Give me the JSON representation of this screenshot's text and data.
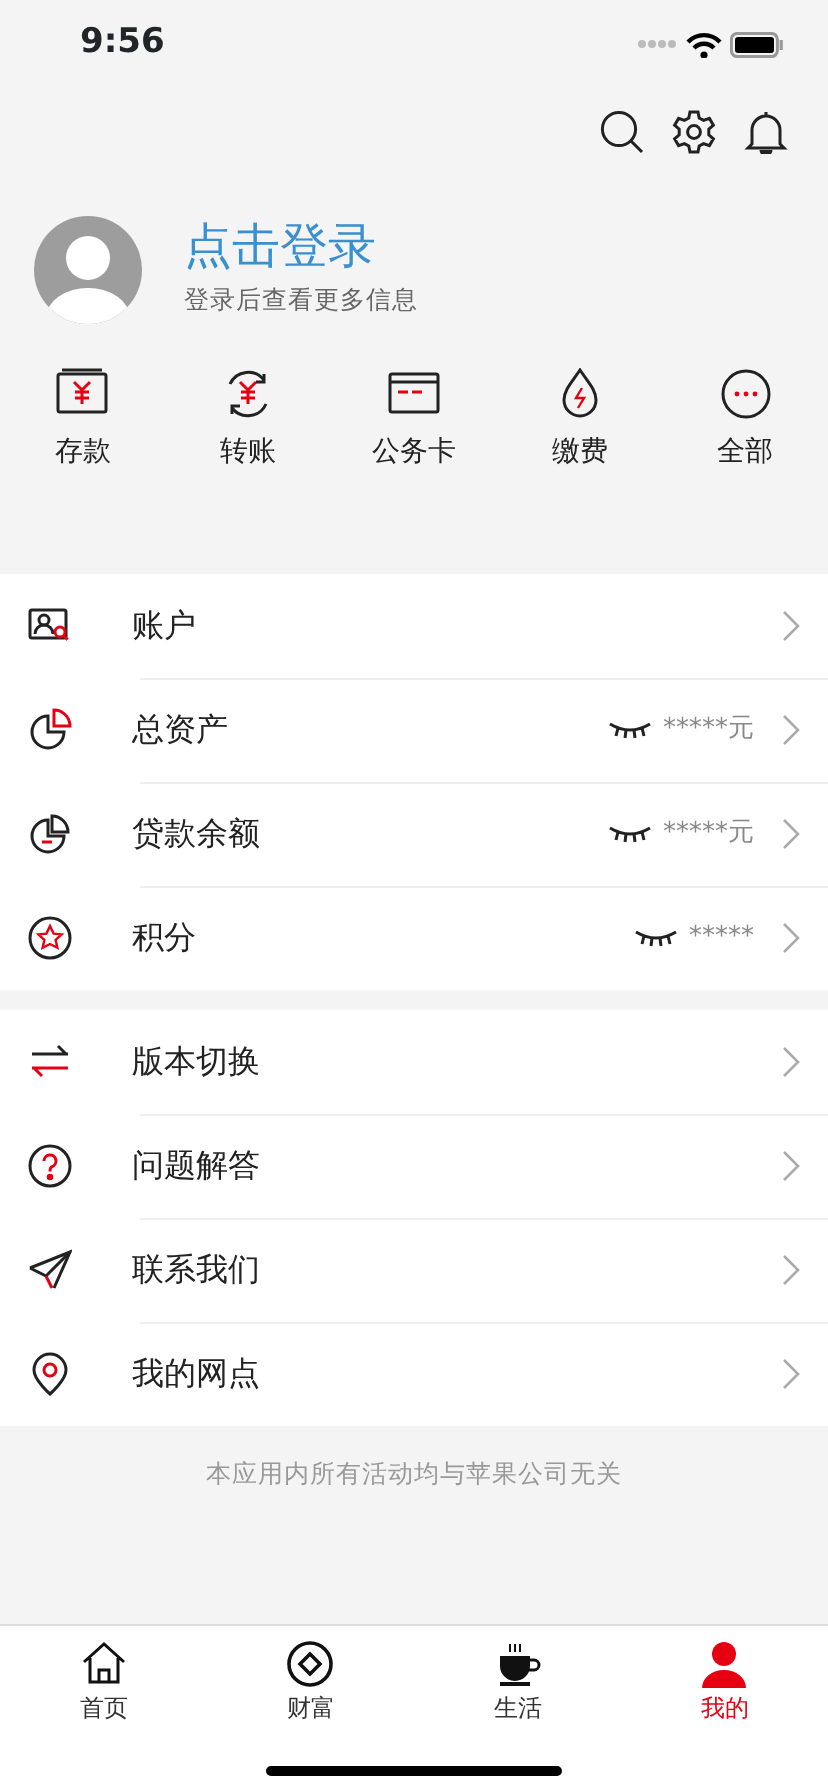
{
  "status_bar": {
    "time": "9:56"
  },
  "profile": {
    "title": "点击登录",
    "subtitle": "登录后查看更多信息"
  },
  "quick_actions": [
    {
      "label": "存款"
    },
    {
      "label": "转账"
    },
    {
      "label": "公务卡"
    },
    {
      "label": "缴费"
    },
    {
      "label": "全部"
    }
  ],
  "account_menu": [
    {
      "label": "账户"
    },
    {
      "label": "总资产",
      "masked_value": "*****元"
    },
    {
      "label": "贷款余额",
      "masked_value": "*****元"
    },
    {
      "label": "积分",
      "masked_value": "*****"
    }
  ],
  "service_menu": [
    {
      "label": "版本切换"
    },
    {
      "label": "问题解答"
    },
    {
      "label": "联系我们"
    },
    {
      "label": "我的网点"
    }
  ],
  "footer_note": "本应用内所有活动均与苹果公司无关",
  "tab_bar": [
    {
      "label": "首页",
      "selected": false
    },
    {
      "label": "财富",
      "selected": false
    },
    {
      "label": "生活",
      "selected": false
    },
    {
      "label": "我的",
      "selected": true
    }
  ]
}
